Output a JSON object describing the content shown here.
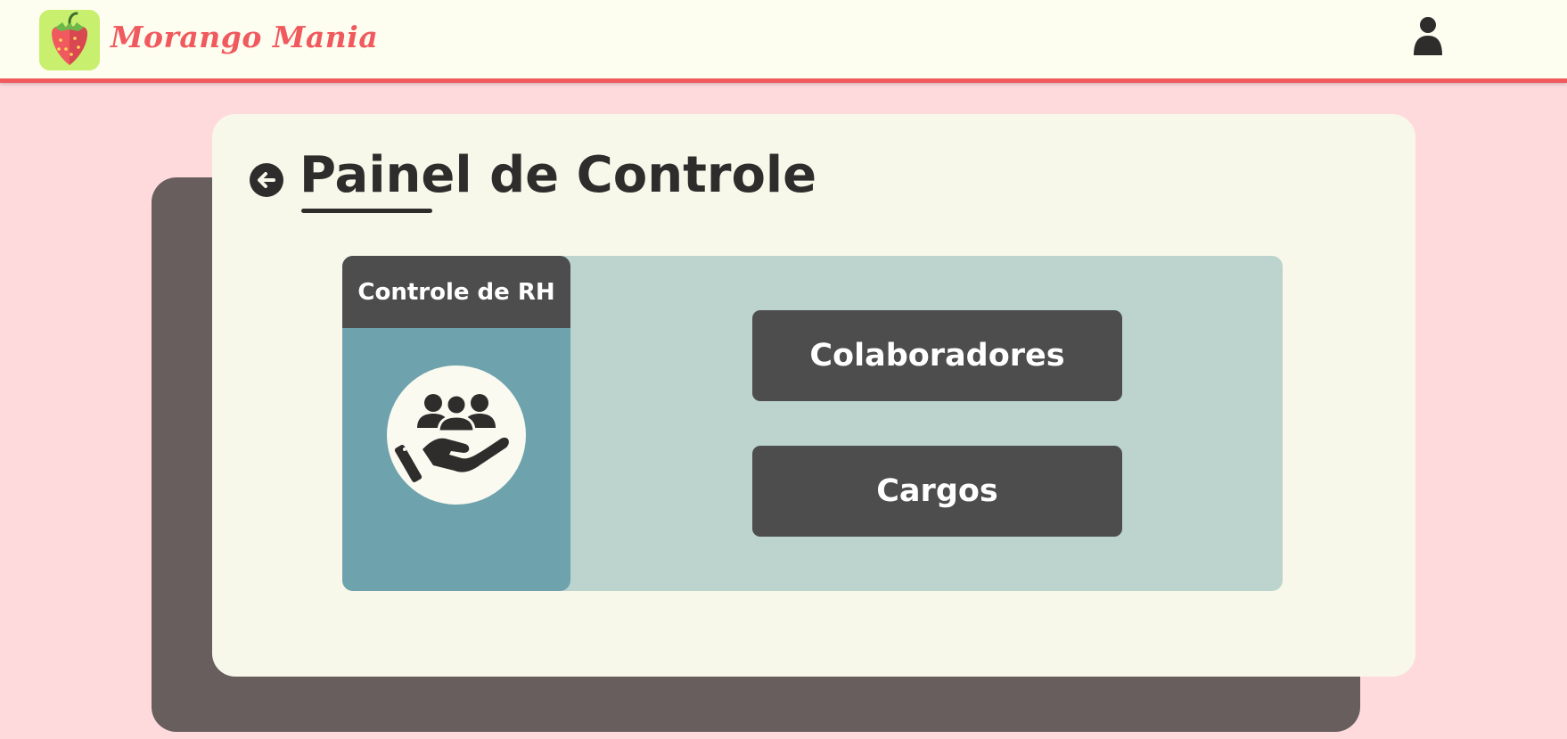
{
  "header": {
    "brand": "Morango Mania",
    "logo_icon": "strawberry-icon",
    "user_icon": "user-icon",
    "accent_color": "#f05a5e"
  },
  "page": {
    "title": "Painel de Controle",
    "back_icon": "arrow-left-circle-icon"
  },
  "rh_card": {
    "title": "Controle de RH",
    "icon": "team-care-hand-icon"
  },
  "buttons": {
    "colaboradores": "Colaboradores",
    "cargos": "Cargos"
  }
}
